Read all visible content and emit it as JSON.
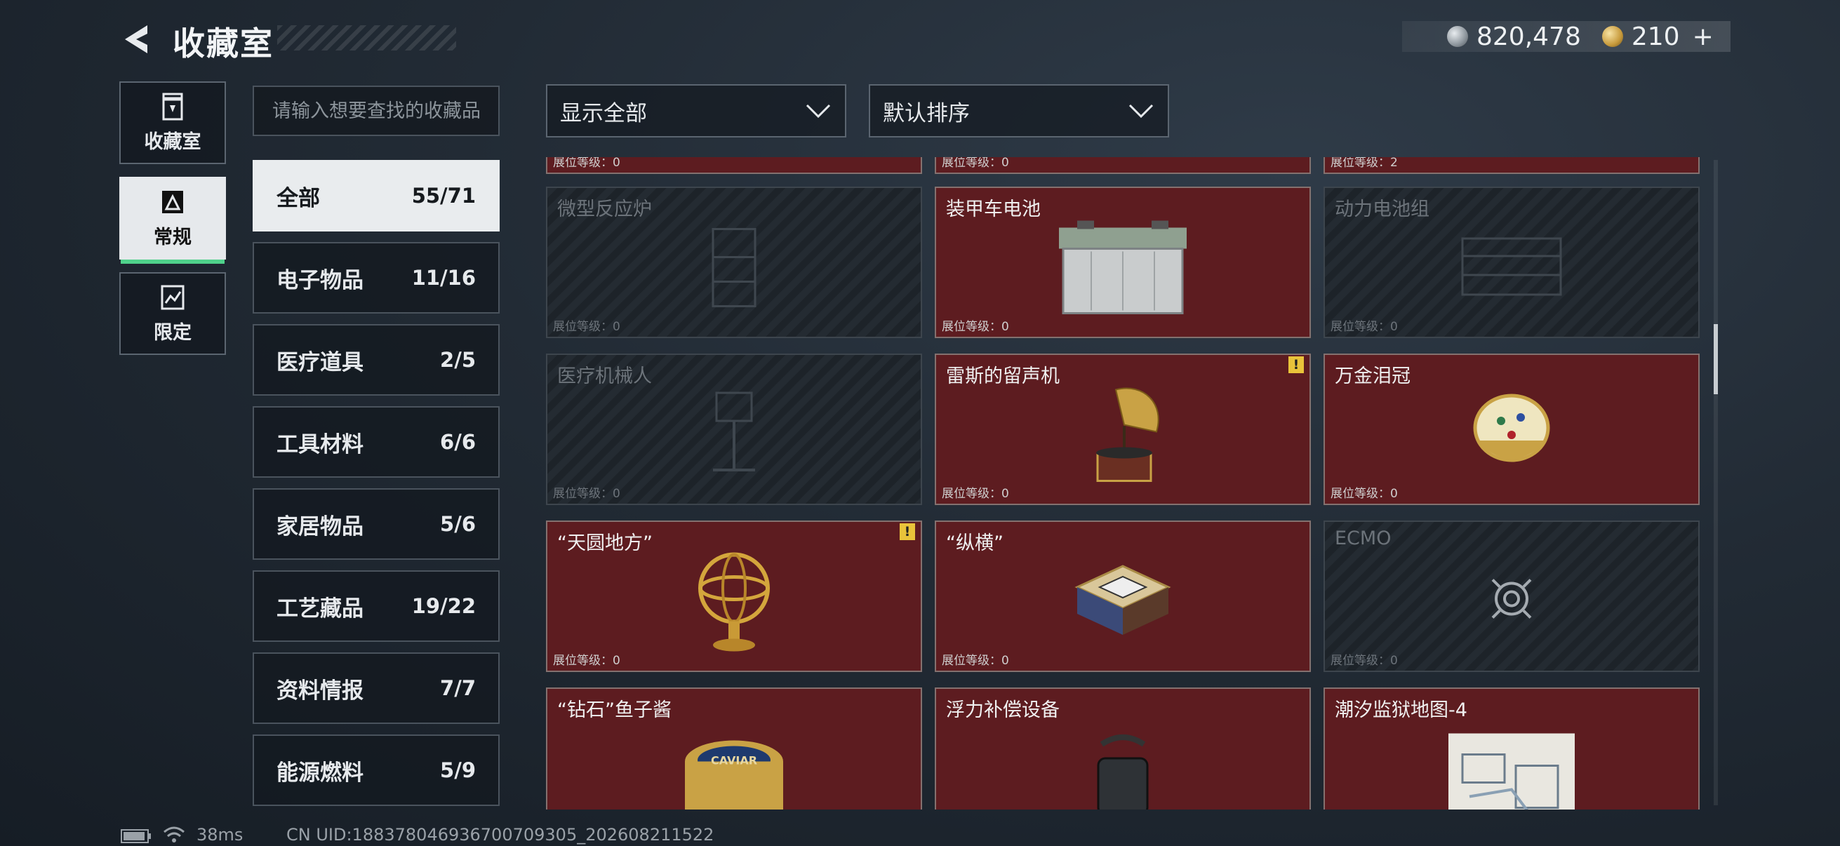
{
  "header": {
    "title": "收藏室",
    "currencies": [
      {
        "icon": "silver-coin-icon",
        "value": "820,478"
      },
      {
        "icon": "gold-coin-icon",
        "value": "210"
      }
    ],
    "add_symbol": "+"
  },
  "mode_tabs": [
    {
      "label": "收藏室",
      "icon": "trash-can-icon",
      "active": false
    },
    {
      "label": "常规",
      "icon": "document-icon",
      "active": true
    },
    {
      "label": "限定",
      "icon": "chart-icon",
      "active": false
    }
  ],
  "search": {
    "placeholder": "请输入想要查找的收藏品"
  },
  "categories": [
    {
      "label": "全部",
      "count": "55/71",
      "active": true
    },
    {
      "label": "电子物品",
      "count": "11/16"
    },
    {
      "label": "医疗道具",
      "count": "2/5"
    },
    {
      "label": "工具材料",
      "count": "6/6"
    },
    {
      "label": "家居物品",
      "count": "5/6"
    },
    {
      "label": "工艺藏品",
      "count": "19/22"
    },
    {
      "label": "资料情报",
      "count": "7/7"
    },
    {
      "label": "能源燃料",
      "count": "5/9"
    }
  ],
  "filters": {
    "show": "显示全部",
    "sort": "默认排序"
  },
  "partial_row": [
    {
      "level": "展位等级：0"
    },
    {
      "level": "展位等级：0"
    },
    {
      "level": "展位等级：2"
    }
  ],
  "cards": [
    {
      "name": "微型反应炉",
      "level": "展位等级：0",
      "locked": true
    },
    {
      "name": "装甲车电池",
      "level": "展位等级：0",
      "locked": false
    },
    {
      "name": "动力电池组",
      "level": "展位等级：0",
      "locked": true
    },
    {
      "name": "医疗机械人",
      "level": "展位等级：0",
      "locked": true
    },
    {
      "name": "雷斯的留声机",
      "level": "展位等级：0",
      "locked": false,
      "warning": "!"
    },
    {
      "name": "万金泪冠",
      "level": "展位等级：0",
      "locked": false
    },
    {
      "name": "“天圆地方”",
      "level": "展位等级：0",
      "locked": false,
      "warning": "!"
    },
    {
      "name": "“纵横”",
      "level": "展位等级：0",
      "locked": false
    },
    {
      "name": "ECMO",
      "level": "展位等级：0",
      "locked": true
    },
    {
      "name": "“钻石”鱼子酱",
      "level": "",
      "locked": false,
      "art_text": "CAVIAR"
    },
    {
      "name": "浮力补偿设备",
      "level": "",
      "locked": false
    },
    {
      "name": "潮汐监狱地图-4",
      "level": "",
      "locked": false
    }
  ],
  "status_bar": {
    "ping": "38ms",
    "uid": "CN UID:188378046936700709305_202608211522"
  }
}
